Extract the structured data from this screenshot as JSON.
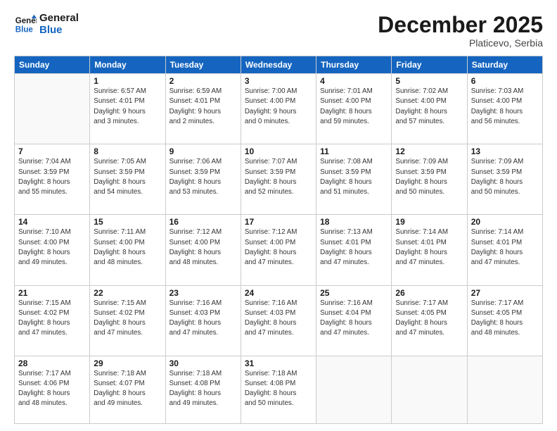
{
  "header": {
    "logo_general": "General",
    "logo_blue": "Blue",
    "month_title": "December 2025",
    "subtitle": "Platicevo, Serbia"
  },
  "days_of_week": [
    "Sunday",
    "Monday",
    "Tuesday",
    "Wednesday",
    "Thursday",
    "Friday",
    "Saturday"
  ],
  "weeks": [
    [
      {
        "day": "",
        "info": ""
      },
      {
        "day": "1",
        "info": "Sunrise: 6:57 AM\nSunset: 4:01 PM\nDaylight: 9 hours\nand 3 minutes."
      },
      {
        "day": "2",
        "info": "Sunrise: 6:59 AM\nSunset: 4:01 PM\nDaylight: 9 hours\nand 2 minutes."
      },
      {
        "day": "3",
        "info": "Sunrise: 7:00 AM\nSunset: 4:00 PM\nDaylight: 9 hours\nand 0 minutes."
      },
      {
        "day": "4",
        "info": "Sunrise: 7:01 AM\nSunset: 4:00 PM\nDaylight: 8 hours\nand 59 minutes."
      },
      {
        "day": "5",
        "info": "Sunrise: 7:02 AM\nSunset: 4:00 PM\nDaylight: 8 hours\nand 57 minutes."
      },
      {
        "day": "6",
        "info": "Sunrise: 7:03 AM\nSunset: 4:00 PM\nDaylight: 8 hours\nand 56 minutes."
      }
    ],
    [
      {
        "day": "7",
        "info": "Sunrise: 7:04 AM\nSunset: 3:59 PM\nDaylight: 8 hours\nand 55 minutes."
      },
      {
        "day": "8",
        "info": "Sunrise: 7:05 AM\nSunset: 3:59 PM\nDaylight: 8 hours\nand 54 minutes."
      },
      {
        "day": "9",
        "info": "Sunrise: 7:06 AM\nSunset: 3:59 PM\nDaylight: 8 hours\nand 53 minutes."
      },
      {
        "day": "10",
        "info": "Sunrise: 7:07 AM\nSunset: 3:59 PM\nDaylight: 8 hours\nand 52 minutes."
      },
      {
        "day": "11",
        "info": "Sunrise: 7:08 AM\nSunset: 3:59 PM\nDaylight: 8 hours\nand 51 minutes."
      },
      {
        "day": "12",
        "info": "Sunrise: 7:09 AM\nSunset: 3:59 PM\nDaylight: 8 hours\nand 50 minutes."
      },
      {
        "day": "13",
        "info": "Sunrise: 7:09 AM\nSunset: 3:59 PM\nDaylight: 8 hours\nand 50 minutes."
      }
    ],
    [
      {
        "day": "14",
        "info": "Sunrise: 7:10 AM\nSunset: 4:00 PM\nDaylight: 8 hours\nand 49 minutes."
      },
      {
        "day": "15",
        "info": "Sunrise: 7:11 AM\nSunset: 4:00 PM\nDaylight: 8 hours\nand 48 minutes."
      },
      {
        "day": "16",
        "info": "Sunrise: 7:12 AM\nSunset: 4:00 PM\nDaylight: 8 hours\nand 48 minutes."
      },
      {
        "day": "17",
        "info": "Sunrise: 7:12 AM\nSunset: 4:00 PM\nDaylight: 8 hours\nand 47 minutes."
      },
      {
        "day": "18",
        "info": "Sunrise: 7:13 AM\nSunset: 4:01 PM\nDaylight: 8 hours\nand 47 minutes."
      },
      {
        "day": "19",
        "info": "Sunrise: 7:14 AM\nSunset: 4:01 PM\nDaylight: 8 hours\nand 47 minutes."
      },
      {
        "day": "20",
        "info": "Sunrise: 7:14 AM\nSunset: 4:01 PM\nDaylight: 8 hours\nand 47 minutes."
      }
    ],
    [
      {
        "day": "21",
        "info": "Sunrise: 7:15 AM\nSunset: 4:02 PM\nDaylight: 8 hours\nand 47 minutes."
      },
      {
        "day": "22",
        "info": "Sunrise: 7:15 AM\nSunset: 4:02 PM\nDaylight: 8 hours\nand 47 minutes."
      },
      {
        "day": "23",
        "info": "Sunrise: 7:16 AM\nSunset: 4:03 PM\nDaylight: 8 hours\nand 47 minutes."
      },
      {
        "day": "24",
        "info": "Sunrise: 7:16 AM\nSunset: 4:03 PM\nDaylight: 8 hours\nand 47 minutes."
      },
      {
        "day": "25",
        "info": "Sunrise: 7:16 AM\nSunset: 4:04 PM\nDaylight: 8 hours\nand 47 minutes."
      },
      {
        "day": "26",
        "info": "Sunrise: 7:17 AM\nSunset: 4:05 PM\nDaylight: 8 hours\nand 47 minutes."
      },
      {
        "day": "27",
        "info": "Sunrise: 7:17 AM\nSunset: 4:05 PM\nDaylight: 8 hours\nand 48 minutes."
      }
    ],
    [
      {
        "day": "28",
        "info": "Sunrise: 7:17 AM\nSunset: 4:06 PM\nDaylight: 8 hours\nand 48 minutes."
      },
      {
        "day": "29",
        "info": "Sunrise: 7:18 AM\nSunset: 4:07 PM\nDaylight: 8 hours\nand 49 minutes."
      },
      {
        "day": "30",
        "info": "Sunrise: 7:18 AM\nSunset: 4:08 PM\nDaylight: 8 hours\nand 49 minutes."
      },
      {
        "day": "31",
        "info": "Sunrise: 7:18 AM\nSunset: 4:08 PM\nDaylight: 8 hours\nand 50 minutes."
      },
      {
        "day": "",
        "info": ""
      },
      {
        "day": "",
        "info": ""
      },
      {
        "day": "",
        "info": ""
      }
    ]
  ]
}
